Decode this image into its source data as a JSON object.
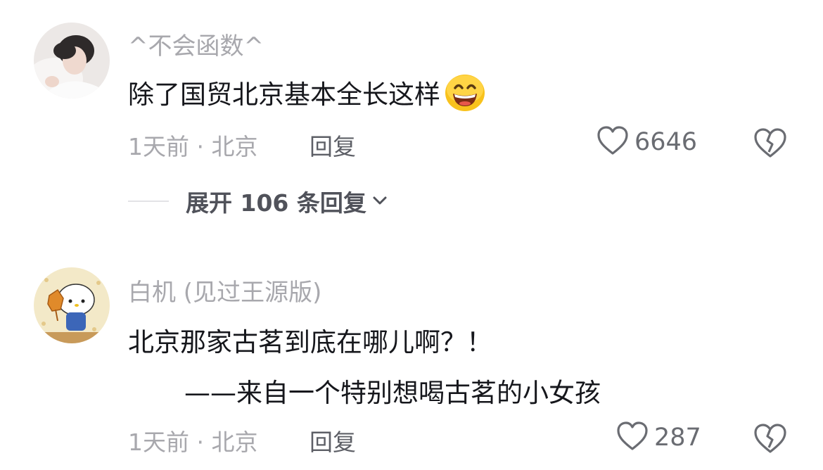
{
  "comments": [
    {
      "username": "^不会函数^",
      "text": "除了国贸北京基本全长这样",
      "emoji": "grinning-face-emoji",
      "meta": "1天前 · 北京",
      "reply_label": "回复",
      "likes": "6646",
      "expand_label": "展开 106 条回复"
    },
    {
      "username": "白机 (见过王源版)",
      "text_line1": "北京那家古茗到底在哪儿啊？！",
      "text_line2": "——来自一个特别想喝古茗的小女孩",
      "meta": "1天前 · 北京",
      "reply_label": "回复",
      "likes": "287"
    }
  ],
  "icons": {
    "like": "heart-outline-icon",
    "dislike": "broken-heart-icon",
    "expand": "chevron-down-icon"
  },
  "colors": {
    "text": "#16171c",
    "muted": "#a8a8ad",
    "icon": "#6a6c72"
  }
}
